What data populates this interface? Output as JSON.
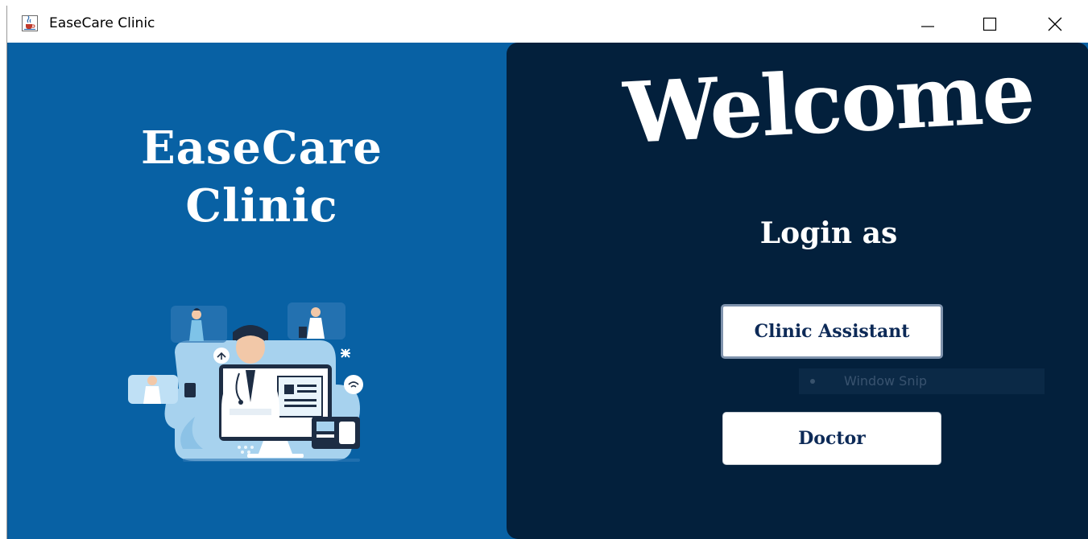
{
  "window": {
    "title": "EaseCare Clinic",
    "icon": "java-coffee-cup-icon",
    "controls": {
      "minimize": "minimize-icon",
      "maximize": "maximize-icon",
      "close": "close-icon"
    }
  },
  "left_panel": {
    "brand_line1": "EaseCare",
    "brand_line2": "Clinic",
    "illustration": "telemedicine-doctor-illustration"
  },
  "right_panel": {
    "heading": "Welcome",
    "subheading": "Login as",
    "buttons": {
      "clinic_assistant": "Clinic Assistant",
      "doctor": "Doctor"
    },
    "overlay_text": "Window Snip"
  },
  "colors": {
    "left_background": "#0861a4",
    "right_background": "#03203c",
    "button_text": "#0d2a57",
    "text_light": "#ffffff"
  }
}
